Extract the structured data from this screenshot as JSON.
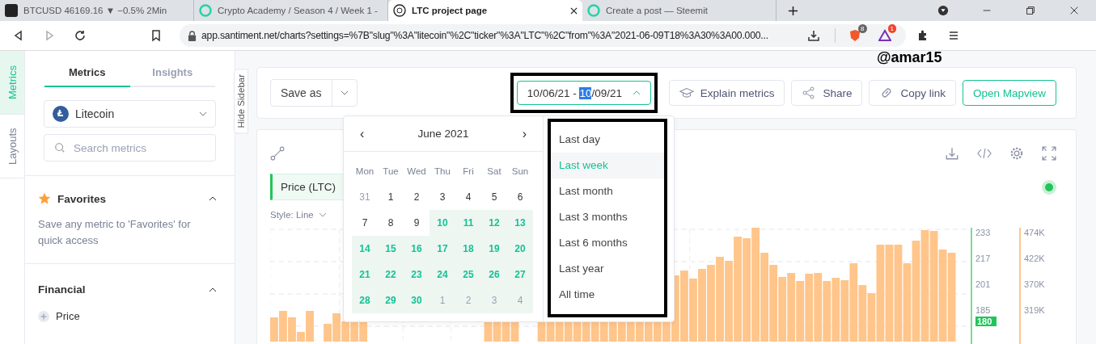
{
  "browser": {
    "tabs": [
      {
        "title": "BTCUSD 46169.16 ▼ −0.5% 2Min",
        "selected": false
      },
      {
        "title": "Crypto Academy / Season 4 / Week 1 -",
        "selected": false
      },
      {
        "title": "LTC project page",
        "selected": true
      },
      {
        "title": "Create a post — Steemit",
        "selected": false
      }
    ],
    "url": "app.santiment.net/charts?settings=%7B\"slug\"%3A\"litecoin\"%2C\"ticker\"%3A\"LTC\"%2C\"from\"%3A\"2021-06-09T18%3A30%3A00.000...",
    "extension_badges": [
      "8",
      "1"
    ]
  },
  "annotation": "@amar15",
  "rail": [
    {
      "label": "Metrics",
      "selected": true
    },
    {
      "label": "Layouts",
      "selected": false
    }
  ],
  "sidebar": {
    "tabs": [
      {
        "label": "Metrics",
        "selected": true
      },
      {
        "label": "Insights",
        "selected": false
      }
    ],
    "asset": "Litecoin",
    "search": {
      "placeholder": "Search metrics"
    },
    "favorites": {
      "title": "Favorites",
      "description": "Save any metric to 'Favorites' for quick access",
      "expanded": true
    },
    "financial": {
      "title": "Financial",
      "expanded": true,
      "items": [
        "Price"
      ]
    },
    "hide_label": "Hide Sidebar"
  },
  "toolbar": {
    "save": "Save as",
    "date": {
      "before": "10/06/21 - ",
      "highlighted": "10",
      "after": "/09/21"
    },
    "buttons": [
      {
        "label": "Explain metrics",
        "kind": "explain"
      },
      {
        "label": "Share",
        "kind": "share"
      },
      {
        "label": "Copy link",
        "kind": "link"
      }
    ],
    "primary": "Open Mapview"
  },
  "calendar": {
    "month": "June 2021",
    "prev": "‹",
    "next": "›",
    "weekdays": [
      "Mon",
      "Tue",
      "Wed",
      "Thu",
      "Fri",
      "Sat",
      "Sun"
    ],
    "weeks": [
      [
        {
          "day": "31",
          "other_month": true,
          "in_range": false
        },
        {
          "day": "1",
          "other_month": false,
          "in_range": false
        },
        {
          "day": "2",
          "other_month": false,
          "in_range": false
        },
        {
          "day": "3",
          "other_month": false,
          "in_range": false
        },
        {
          "day": "4",
          "other_month": false,
          "in_range": false
        },
        {
          "day": "5",
          "other_month": false,
          "in_range": false
        },
        {
          "day": "6",
          "other_month": false,
          "in_range": false
        }
      ],
      [
        {
          "day": "7",
          "other_month": false,
          "in_range": false
        },
        {
          "day": "8",
          "other_month": false,
          "in_range": false
        },
        {
          "day": "9",
          "other_month": false,
          "in_range": false
        },
        {
          "day": "10",
          "other_month": false,
          "in_range": true
        },
        {
          "day": "11",
          "other_month": false,
          "in_range": true
        },
        {
          "day": "12",
          "other_month": false,
          "in_range": true
        },
        {
          "day": "13",
          "other_month": false,
          "in_range": true
        }
      ],
      [
        {
          "day": "14",
          "other_month": false,
          "in_range": true
        },
        {
          "day": "15",
          "other_month": false,
          "in_range": true
        },
        {
          "day": "16",
          "other_month": false,
          "in_range": true
        },
        {
          "day": "17",
          "other_month": false,
          "in_range": true
        },
        {
          "day": "18",
          "other_month": false,
          "in_range": true
        },
        {
          "day": "19",
          "other_month": false,
          "in_range": true
        },
        {
          "day": "20",
          "other_month": false,
          "in_range": true
        }
      ],
      [
        {
          "day": "21",
          "other_month": false,
          "in_range": true
        },
        {
          "day": "22",
          "other_month": false,
          "in_range": true
        },
        {
          "day": "23",
          "other_month": false,
          "in_range": true
        },
        {
          "day": "24",
          "other_month": false,
          "in_range": true
        },
        {
          "day": "25",
          "other_month": false,
          "in_range": true
        },
        {
          "day": "26",
          "other_month": false,
          "in_range": true
        },
        {
          "day": "27",
          "other_month": false,
          "in_range": true
        }
      ],
      [
        {
          "day": "28",
          "other_month": false,
          "in_range": true
        },
        {
          "day": "29",
          "other_month": false,
          "in_range": true
        },
        {
          "day": "30",
          "other_month": false,
          "in_range": true
        },
        {
          "day": "1",
          "other_month": true,
          "in_range": true
        },
        {
          "day": "2",
          "other_month": true,
          "in_range": true
        },
        {
          "day": "3",
          "other_month": true,
          "in_range": true
        },
        {
          "day": "4",
          "other_month": true,
          "in_range": true
        }
      ]
    ]
  },
  "presets": [
    {
      "label": "Last day",
      "selected": false
    },
    {
      "label": "Last week",
      "selected": true
    },
    {
      "label": "Last month",
      "selected": false
    },
    {
      "label": "Last 3 months",
      "selected": false
    },
    {
      "label": "Last 6 months",
      "selected": false
    },
    {
      "label": "Last year",
      "selected": false
    },
    {
      "label": "All time",
      "selected": false
    }
  ],
  "chart": {
    "metric": "Price (LTC)",
    "style": "Style: Line",
    "price_axis": [
      "233",
      "217",
      "201",
      "185"
    ],
    "volume_axis": [
      "474K",
      "422K",
      "370K",
      "319K"
    ],
    "last_price": "180"
  }
}
